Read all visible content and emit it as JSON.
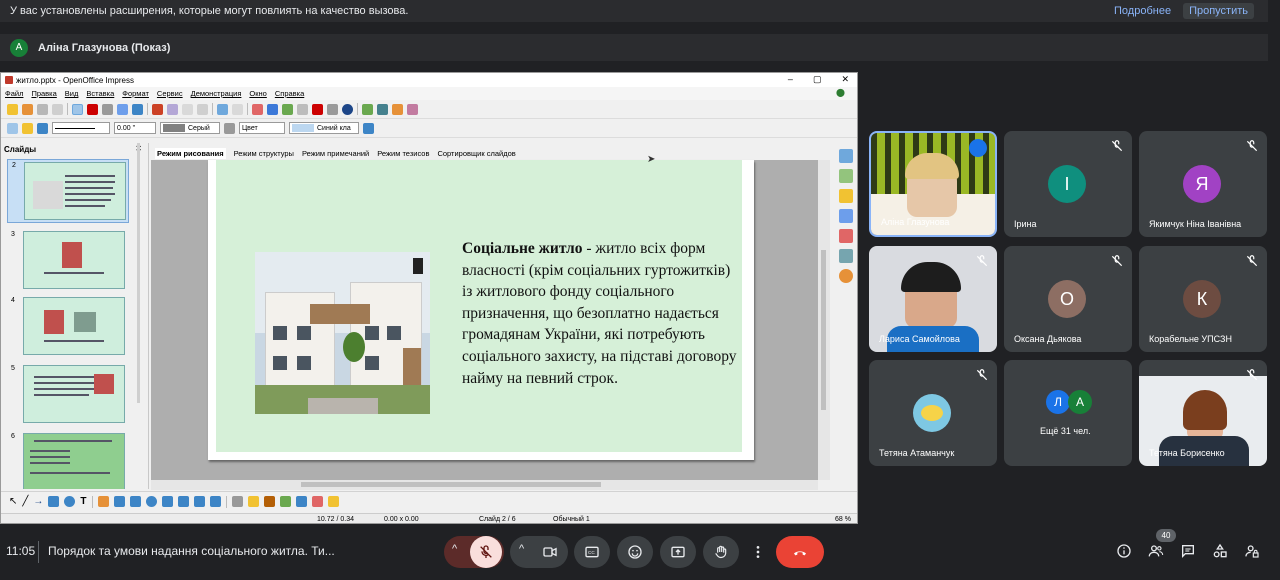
{
  "notice": {
    "text": "У вас установлены расширения, которые могут повлиять на качество вызова.",
    "more": "Подробнее",
    "skip": "Пропустить"
  },
  "presenter": {
    "initial": "A",
    "label": "Аліна Глазунова (Показ)"
  },
  "impress": {
    "title": "житло.pptx - OpenOffice Impress",
    "menu": [
      "Файл",
      "Правка",
      "Вид",
      "Вставка",
      "Формат",
      "Сервис",
      "Демонстрация",
      "Окно",
      "Справка"
    ],
    "line_width": "0.00 \"",
    "fill_color": "Серый",
    "fill_mode": "Цвет",
    "line_color": "Синий кла",
    "slides_pane_title": "Слайды",
    "view_tabs": [
      "Режим рисования",
      "Режим структуры",
      "Режим примечаний",
      "Режим тезисов",
      "Сортировщик слайдов"
    ],
    "thumb_numbers": [
      "2",
      "3",
      "4",
      "5",
      "6"
    ],
    "slide_text_bold": "Соціальне житло",
    "slide_text_rest": " - житло всіх форм власності (крім соціальних гуртожитків) із житлового фонду соціального призначення, що безоплатно надається громадянам України, які потребують соціального захисту, на підставі договору найму на певний строк.",
    "status": {
      "position": "10.72 / 0.34",
      "size": "0.00 x 0.00",
      "slide": "Слайд 2 / 6",
      "layout": "Обычный 1",
      "zoom": "68 %"
    }
  },
  "participants": [
    {
      "name": "Аліна Глазунова",
      "type": "video",
      "speaking": true
    },
    {
      "name": "Ірина",
      "initial": "І",
      "color": "#0f8f7e"
    },
    {
      "name": "Якимчук Ніна Іванівна",
      "initial": "Я",
      "color": "#a142c4"
    },
    {
      "name": "Лариса Самойлова",
      "type": "video"
    },
    {
      "name": "Оксана Дьякова",
      "initial": "О",
      "color": "#8d6e63"
    },
    {
      "name": "Корабельне УПСЗН",
      "initial": "К",
      "color": "#6d4c41"
    },
    {
      "name": "Тетяна Атаманчук",
      "type": "avatar"
    },
    {
      "name": "Ещё 31 чел.",
      "initials": [
        "Л",
        "А"
      ]
    },
    {
      "name": "Тетяна Борисенко",
      "type": "video"
    }
  ],
  "colors": {
    "bg": "#202124",
    "tile": "#3c4043",
    "end_call": "#ea4335",
    "mic_off": "#f9dedc",
    "accent": "#8ab4f8"
  },
  "bottom": {
    "time": "11:05",
    "meeting": "Порядок та умови надання соціального житла. Ти...",
    "people_count": "40"
  }
}
